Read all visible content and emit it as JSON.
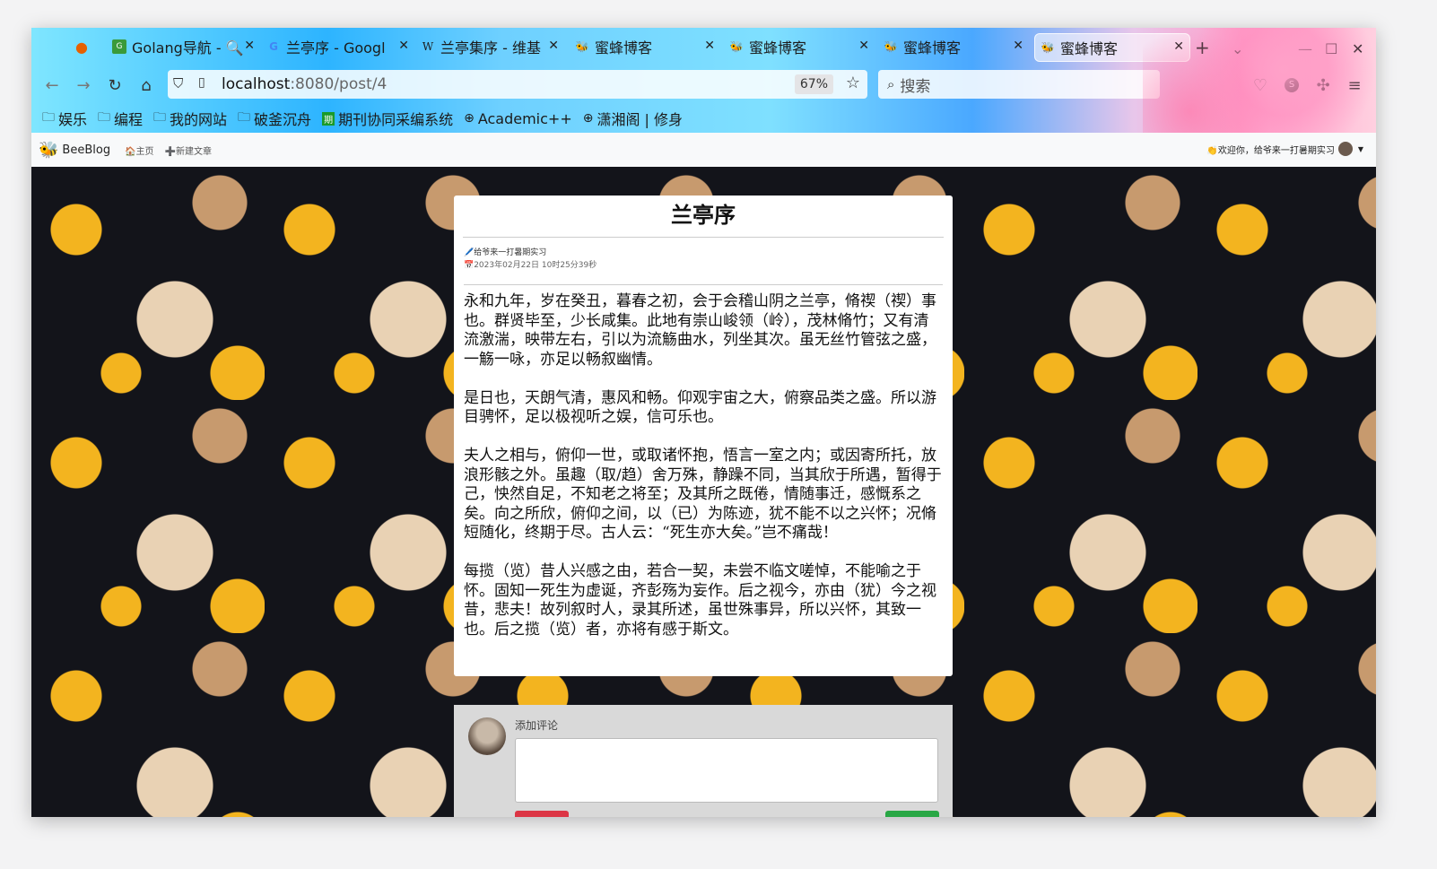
{
  "browser": {
    "tabs": [
      {
        "label": "Golang导航 - 🔍",
        "icon": "golang-nav-favicon"
      },
      {
        "label": "兰亭序 - Googl",
        "icon": "google-favicon"
      },
      {
        "label": "兰亭集序 - 维基",
        "icon": "wikipedia-favicon"
      },
      {
        "label": "蜜蜂博客",
        "icon": "bee-favicon"
      },
      {
        "label": "蜜蜂博客",
        "icon": "bee-favicon"
      },
      {
        "label": "蜜蜂博客",
        "icon": "bee-favicon"
      },
      {
        "label": "蜜蜂博客",
        "icon": "bee-favicon",
        "active": true
      }
    ],
    "url_host": "localhost",
    "url_path": ":8080/post/4",
    "zoom": "67%",
    "search_placeholder": "搜索",
    "bookmarks": [
      {
        "label": "娱乐",
        "icon": "folder-icon"
      },
      {
        "label": "编程",
        "icon": "folder-icon"
      },
      {
        "label": "我的网站",
        "icon": "folder-icon"
      },
      {
        "label": "破釜沉舟",
        "icon": "folder-icon"
      },
      {
        "label": "期刊协同采编系统",
        "icon": "journal-favicon"
      },
      {
        "label": "Academic++",
        "icon": "globe-icon"
      },
      {
        "label": "潇湘阁 | 修身",
        "icon": "globe-icon"
      }
    ]
  },
  "site": {
    "brand": "BeeBlog",
    "nav": [
      "🏠主页",
      "➕新建文章"
    ],
    "welcome": "👏欢迎你，给爷来一打暑期实习"
  },
  "post": {
    "title": "兰亭序",
    "author": "🖊️给爷来一打暑期实习",
    "date": "📅2023年02月22日 10时25分39秒",
    "paragraphs": [
      "永和九年，岁在癸丑，暮春之初，会于会稽山阴之兰亭，脩禊（禊）事也。群贤毕至，少长咸集。此地有崇山峻领（岭），茂林脩竹；又有清流激湍，映带左右，引以为流觞曲水，列坐其次。虽无丝竹管弦之盛，一觞一咏，亦足以畅叙幽情。",
      "是日也，天朗气清，惠风和畅。仰观宇宙之大，俯察品类之盛。所以游目骋怀，足以极视听之娱，信可乐也。",
      "夫人之相与，俯仰一世，或取诸怀抱，悟言一室之内；或因寄所托，放浪形骸之外。虽趣（取/趋）舍万殊，静躁不同，当其欣于所遇，暂得于己，怏然自足，不知老之将至；及其所之既倦，情随事迁，感慨系之矣。向之所欣，俯仰之间，以（已）为陈迹，犹不能不以之兴怀；况脩短随化，终期于尽。古人云：“死生亦大矣。”岂不痛哉！",
      "每揽（览）昔人兴感之由，若合一契，未尝不临文嗟悼，不能喻之于怀。固知一死生为虚诞，齐彭殇为妄作。后之视今，亦由（犹）今之视昔，悲夫！故列叙时人，录其所述，虽世殊事异，所以兴怀，其致一也。后之揽（览）者，亦将有感于斯文。"
    ]
  },
  "comment": {
    "label": "添加评论"
  }
}
